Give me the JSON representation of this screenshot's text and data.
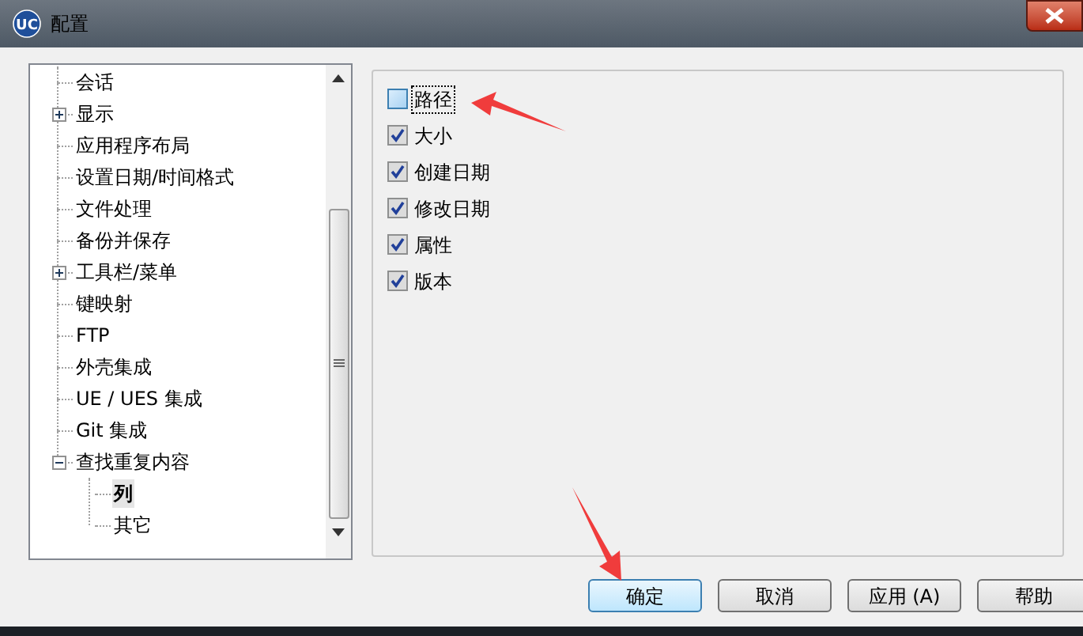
{
  "window": {
    "logo": "UC",
    "title": "配置"
  },
  "tree": [
    {
      "label": "会话",
      "selected": false
    },
    {
      "label": "显示",
      "selected": false,
      "expanded": false
    },
    {
      "label": "应用程序布局",
      "selected": false
    },
    {
      "label": "设置日期/时间格式",
      "selected": false
    },
    {
      "label": "文件处理",
      "selected": false
    },
    {
      "label": "备份并保存",
      "selected": false
    },
    {
      "label": "工具栏/菜单",
      "selected": false,
      "expanded": false
    },
    {
      "label": "键映射",
      "selected": false
    },
    {
      "label": "FTP",
      "selected": false
    },
    {
      "label": "外壳集成",
      "selected": false
    },
    {
      "label": "UE / UES 集成",
      "selected": false
    },
    {
      "label": "Git 集成",
      "selected": false
    },
    {
      "label": "查找重复内容",
      "selected": false,
      "expanded": true,
      "children": [
        {
          "label": "列",
          "selected": true
        },
        {
          "label": "其它",
          "selected": false
        }
      ]
    }
  ],
  "options": [
    {
      "label": "路径",
      "checked": false,
      "focused": true
    },
    {
      "label": "大小",
      "checked": true,
      "focused": false
    },
    {
      "label": "创建日期",
      "checked": true,
      "focused": false
    },
    {
      "label": "修改日期",
      "checked": true,
      "focused": false
    },
    {
      "label": "属性",
      "checked": true,
      "focused": false
    },
    {
      "label": "版本",
      "checked": true,
      "focused": false
    }
  ],
  "buttons": [
    {
      "label": "确定",
      "default": true
    },
    {
      "label": "取消",
      "default": false
    },
    {
      "label": "应用 (A)",
      "default": false
    },
    {
      "label": "帮助",
      "default": false
    }
  ]
}
